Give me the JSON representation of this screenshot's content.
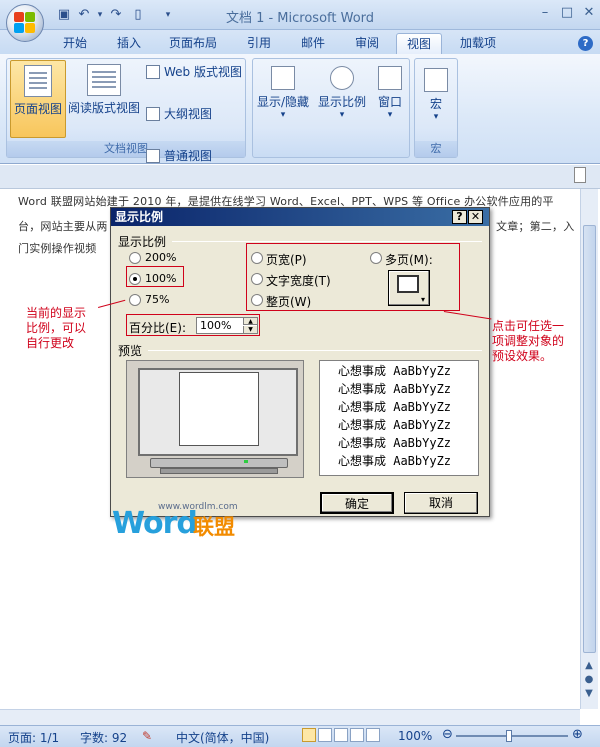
{
  "window": {
    "title": "文档 1 - Microsoft Word",
    "minimize": "–",
    "maximize": "□",
    "close": "✕"
  },
  "tabs": [
    {
      "label": "开始"
    },
    {
      "label": "插入"
    },
    {
      "label": "页面布局"
    },
    {
      "label": "引用"
    },
    {
      "label": "邮件"
    },
    {
      "label": "审阅"
    },
    {
      "label": "视图",
      "active": true
    },
    {
      "label": "加载项"
    }
  ],
  "ribbon": {
    "doc_views": {
      "label": "文档视图",
      "page_view": "页面视图",
      "reading_view": "阅读版式视图",
      "web_view": "Web 版式视图",
      "outline_view": "大纲视图",
      "draft_view": "普通视图"
    },
    "show_hide": "显示/隐藏",
    "zoom": "显示比例",
    "window": "窗口",
    "macros": "宏",
    "macros_group": "宏",
    "dropdown": "▾"
  },
  "document": {
    "line1": "Word 联盟网站始建于 2010 年，是提供在线学习 Word、Excel、PPT、WPS 等 Office 办公软件应用的平",
    "line2_left": "台，网站主要从两",
    "line2_right": "文章；第二，入",
    "line3": "门实例操作视频"
  },
  "dialog": {
    "title": "显示比例",
    "help": "?",
    "close": "✕",
    "zoom_group": "显示比例",
    "opt_200": "200%",
    "opt_100": "100%",
    "opt_75": "75%",
    "page_width": "页宽(P)",
    "text_width": "文字宽度(T)",
    "whole_page": "整页(W)",
    "many_pages": "多页(M):",
    "percent_label": "百分比(E):",
    "percent_value": "100%",
    "preview_label": "预览",
    "preview_lines": [
      "心想事成 AaBbYyZz",
      "心想事成 AaBbYyZz",
      "心想事成 AaBbYyZz",
      "心想事成 AaBbYyZz",
      "心想事成 AaBbYyZz",
      "心想事成 AaBbYyZz"
    ],
    "ok": "确定",
    "cancel": "取消"
  },
  "annotations": {
    "left": [
      "当前的显示",
      "比例，可以",
      "自行更改"
    ],
    "right": [
      "点击可任选一",
      "项调整对象的",
      "预设效果。"
    ]
  },
  "watermark": {
    "url": "www.wordlm.com",
    "brand": "Word",
    "brand_cn": "联盟"
  },
  "statusbar": {
    "page": "页面: 1/1",
    "words": "字数: 92",
    "language": "中文(简体，中国)",
    "zoom": "100%",
    "zoom_out": "⊖",
    "zoom_in": "⊕"
  },
  "colors": {
    "annotation": "#d0021b",
    "title_bar": "#0a246a",
    "watermark_blue": "#27a0dc",
    "watermark_orange": "#f28b00"
  }
}
